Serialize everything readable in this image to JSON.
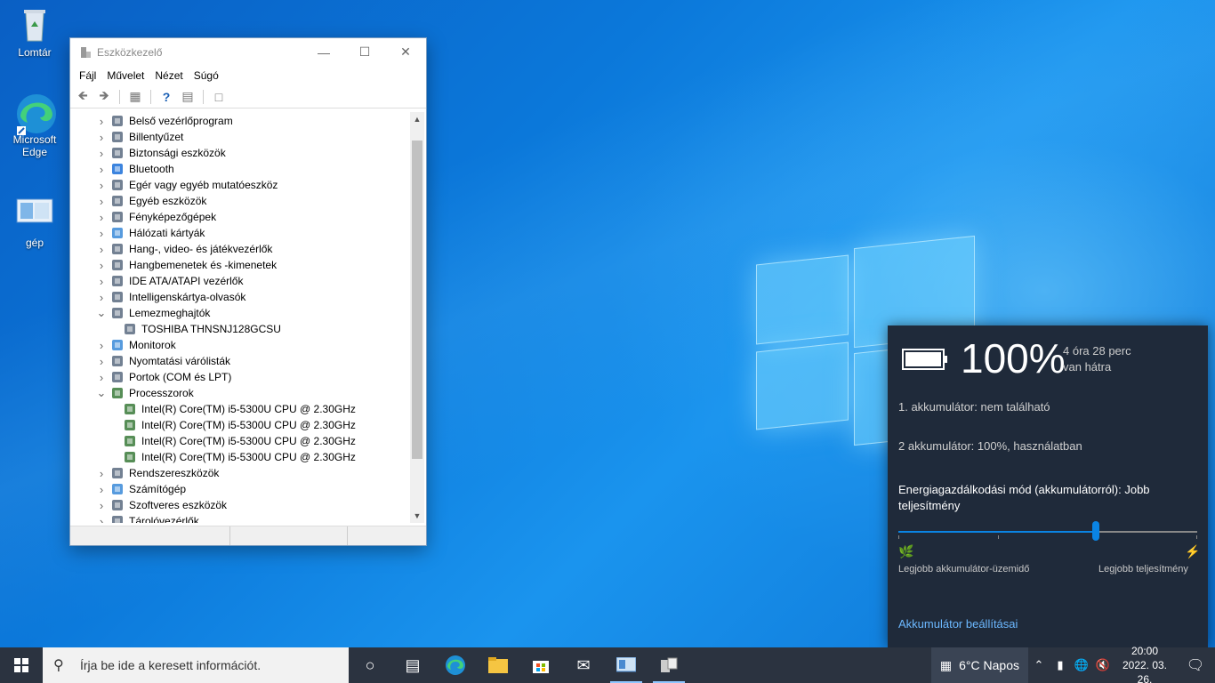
{
  "desktop": {
    "icons": [
      {
        "label": "Lomtár",
        "icon": "recycle-bin-icon"
      },
      {
        "label": "Microsoft Edge",
        "icon": "edge-icon"
      },
      {
        "label": "gép",
        "icon": "computer-icon"
      }
    ]
  },
  "device_manager": {
    "title": "Eszközkezelő",
    "menu": [
      "Fájl",
      "Művelet",
      "Nézet",
      "Súgó"
    ],
    "tree": [
      {
        "label": "Belső vezérlőprogram",
        "type": "category",
        "expanded": false,
        "icon": "firmware-icon"
      },
      {
        "label": "Billentyűzet",
        "type": "category",
        "expanded": false,
        "icon": "keyboard-icon"
      },
      {
        "label": "Biztonsági eszközök",
        "type": "category",
        "expanded": false,
        "icon": "security-device-icon"
      },
      {
        "label": "Bluetooth",
        "type": "category",
        "expanded": false,
        "icon": "bluetooth-icon"
      },
      {
        "label": "Egér vagy egyéb mutatóeszköz",
        "type": "category",
        "expanded": false,
        "icon": "mouse-icon"
      },
      {
        "label": "Egyéb eszközök",
        "type": "category",
        "expanded": false,
        "icon": "other-devices-icon"
      },
      {
        "label": "Fényképezőgépek",
        "type": "category",
        "expanded": false,
        "icon": "camera-icon"
      },
      {
        "label": "Hálózati kártyák",
        "type": "category",
        "expanded": false,
        "icon": "network-adapter-icon"
      },
      {
        "label": "Hang-, video- és játékvezérlők",
        "type": "category",
        "expanded": false,
        "icon": "sound-icon"
      },
      {
        "label": "Hangbemenetek és -kimenetek",
        "type": "category",
        "expanded": false,
        "icon": "audio-io-icon"
      },
      {
        "label": "IDE ATA/ATAPI vezérlők",
        "type": "category",
        "expanded": false,
        "icon": "ide-controller-icon"
      },
      {
        "label": "Intelligenskártya-olvasók",
        "type": "category",
        "expanded": false,
        "icon": "smartcard-reader-icon"
      },
      {
        "label": "Lemezmeghajtók",
        "type": "category",
        "expanded": true,
        "icon": "disk-drive-icon"
      },
      {
        "label": "TOSHIBA THNSNJ128GCSU",
        "type": "device",
        "icon": "disk-drive-icon"
      },
      {
        "label": "Monitorok",
        "type": "category",
        "expanded": false,
        "icon": "monitor-icon"
      },
      {
        "label": "Nyomtatási várólisták",
        "type": "category",
        "expanded": false,
        "icon": "printer-icon"
      },
      {
        "label": "Portok (COM és LPT)",
        "type": "category",
        "expanded": false,
        "icon": "port-icon"
      },
      {
        "label": "Processzorok",
        "type": "category",
        "expanded": true,
        "icon": "processor-icon"
      },
      {
        "label": "Intel(R) Core(TM) i5-5300U CPU @ 2.30GHz",
        "type": "device",
        "icon": "processor-icon"
      },
      {
        "label": "Intel(R) Core(TM) i5-5300U CPU @ 2.30GHz",
        "type": "device",
        "icon": "processor-icon"
      },
      {
        "label": "Intel(R) Core(TM) i5-5300U CPU @ 2.30GHz",
        "type": "device",
        "icon": "processor-icon"
      },
      {
        "label": "Intel(R) Core(TM) i5-5300U CPU @ 2.30GHz",
        "type": "device",
        "icon": "processor-icon"
      },
      {
        "label": "Rendszereszközök",
        "type": "category",
        "expanded": false,
        "icon": "system-devices-icon"
      },
      {
        "label": "Számítógép",
        "type": "category",
        "expanded": false,
        "icon": "computer-icon"
      },
      {
        "label": "Szoftveres eszközök",
        "type": "category",
        "expanded": false,
        "icon": "software-device-icon"
      },
      {
        "label": "Tárolóvezérlők",
        "type": "category",
        "expanded": false,
        "icon": "storage-controller-icon"
      }
    ]
  },
  "battery_flyout": {
    "percent": "100%",
    "time_line1": "4 óra 28 perc",
    "time_line2": "van hátra",
    "battery1": "1. akkumulátor: nem található",
    "battery2": "2 akkumulátor: 100%, használatban",
    "mode": "Energiagazdálkodási mód (akkumulátorról): Jobb teljesítmény",
    "slider_level": 0.66,
    "label_left": "Legjobb akkumulátor-üzemidő",
    "label_right": "Legjobb teljesítmény",
    "settings_link": "Akkumulátor beállításai",
    "accent": "#0a84e4"
  },
  "taskbar": {
    "search_placeholder": "Írja be ide a keresett információt.",
    "weather": "6°C  Napos",
    "time": "20:00",
    "date": "2022. 03. 26."
  }
}
